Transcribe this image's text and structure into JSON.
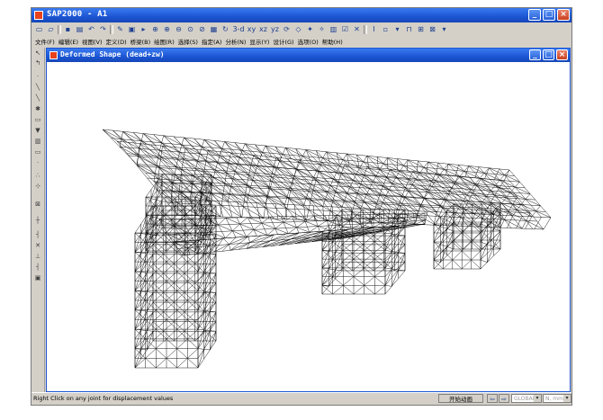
{
  "app": {
    "title": "SAP2000 - A1"
  },
  "toolbar": {
    "icons": [
      "new-icon",
      "open-icon",
      "save-icon",
      "print-icon",
      "undo-icon",
      "redo-icon",
      "pencil-icon",
      "lock-icon",
      "play-icon",
      "zoom-window-icon",
      "zoom-in-icon",
      "zoom-out-icon",
      "zoom-restore-icon",
      "pan-icon",
      "display-icon",
      "refresh-icon"
    ],
    "view_buttons": [
      "3-d",
      "xy",
      "xz",
      "yz"
    ]
  },
  "menu": [
    "文件(F)",
    "编辑(E)",
    "视图(V)",
    "定义(D)",
    "桥梁(B)",
    "绘图(R)",
    "选择(S)",
    "指定(A)",
    "分析(N)",
    "显示(Y)",
    "设计(G)",
    "选项(O)",
    "帮助(H)"
  ],
  "window": {
    "title": "Deformed Shape (dead+zw)"
  },
  "status": {
    "hint": "Right Click on any joint for displacement values",
    "animate_label": "开始动画",
    "coord_system": "GLOBAL",
    "units": "N, mm, C"
  }
}
